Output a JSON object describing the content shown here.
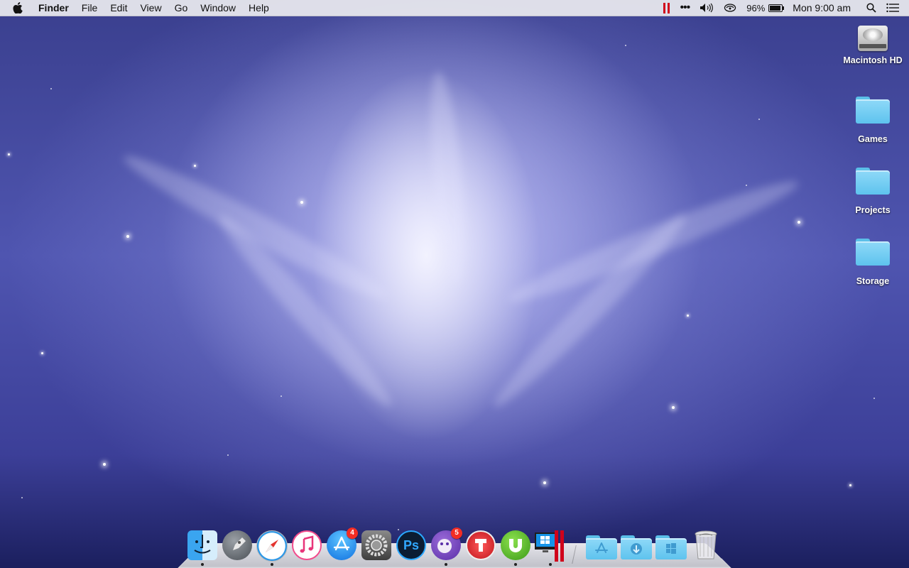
{
  "menubar": {
    "apple_icon": "apple-logo-icon",
    "app_name": "Finder",
    "menus": [
      "File",
      "Edit",
      "View",
      "Go",
      "Window",
      "Help"
    ],
    "status": {
      "parallels_icon": "parallels-icon",
      "more_icon": "more-dots-icon",
      "volume_icon": "volume-icon",
      "cloud_icon": "cloud-sync-icon",
      "battery_percent": "96%",
      "battery_level": 0.96,
      "battery_charging": true,
      "clock": "Mon 9:00 am",
      "spotlight_icon": "search-icon",
      "notifications_icon": "notification-list-icon"
    }
  },
  "desktop_icons": [
    {
      "label": "Macintosh HD",
      "icon": "hard-drive-icon"
    },
    {
      "label": "Games",
      "icon": "folder-icon"
    },
    {
      "label": "Projects",
      "icon": "folder-icon"
    },
    {
      "label": "Storage",
      "icon": "folder-icon"
    }
  ],
  "dock": {
    "apps": [
      {
        "name": "Finder",
        "icon": "finder-icon",
        "running": true
      },
      {
        "name": "Launchpad",
        "icon": "launchpad-rocket-icon",
        "running": false
      },
      {
        "name": "Safari",
        "icon": "safari-compass-icon",
        "running": true
      },
      {
        "name": "iTunes",
        "icon": "itunes-note-icon",
        "running": false
      },
      {
        "name": "App Store",
        "icon": "app-store-icon",
        "running": false,
        "badge": "4"
      },
      {
        "name": "System Preferences",
        "icon": "gear-icon",
        "running": false
      },
      {
        "name": "Photoshop",
        "icon": "photoshop-icon",
        "running": false,
        "text": "Ps"
      },
      {
        "name": "Tweetbot",
        "icon": "tweetbot-icon",
        "running": true,
        "badge": "5"
      },
      {
        "name": "Transmit",
        "icon": "transmit-icon",
        "running": false
      },
      {
        "name": "uTorrent",
        "icon": "utorrent-icon",
        "running": true
      },
      {
        "name": "Windows",
        "icon": "windows-parallels-icon",
        "running": true
      }
    ],
    "stacks": [
      {
        "name": "Applications",
        "icon": "applications-folder-icon"
      },
      {
        "name": "Downloads",
        "icon": "downloads-folder-icon"
      },
      {
        "name": "Windows Applications",
        "icon": "windows-folder-icon"
      }
    ],
    "trash_icon": "trash-icon"
  }
}
